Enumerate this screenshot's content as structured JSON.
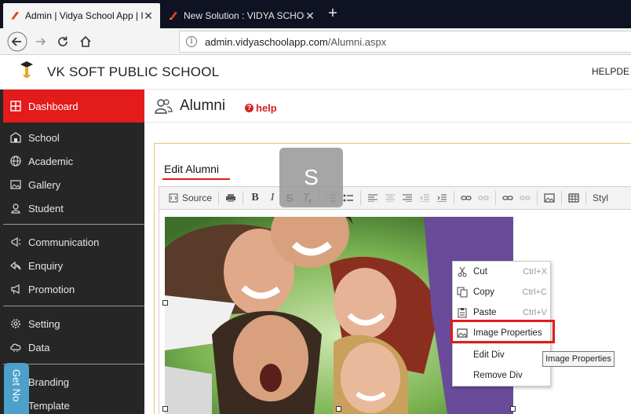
{
  "browser": {
    "tabs": [
      {
        "title": "Admin | Vidya School App | It's",
        "active": true
      },
      {
        "title": "New Solution : VIDYA SCHOOL",
        "active": false
      }
    ],
    "new_tab_label": "+",
    "url_host": "admin.vidyaschoolapp.com",
    "url_path": "/Alumni.aspx"
  },
  "header": {
    "logo_text": "VK SOFT",
    "school_name": "VK SOFT PUBLIC SCHOOL",
    "helpdesk": "HELPDE"
  },
  "sidebar": {
    "items": [
      {
        "label": "Dashboard",
        "icon": "dashboard-icon"
      },
      {
        "label": "School",
        "icon": "school-icon"
      },
      {
        "label": "Academic",
        "icon": "globe-icon"
      },
      {
        "label": "Gallery",
        "icon": "image-icon"
      },
      {
        "label": "Student",
        "icon": "student-icon"
      },
      {
        "label": "Communication",
        "icon": "megaphone-icon"
      },
      {
        "label": "Enquiry",
        "icon": "reply-icon"
      },
      {
        "label": "Promotion",
        "icon": "bullhorn-icon"
      },
      {
        "label": "Setting",
        "icon": "gear-icon"
      },
      {
        "label": "Data",
        "icon": "cloud-icon"
      },
      {
        "label": "Branding",
        "icon": ""
      },
      {
        "label": "Template",
        "icon": ""
      }
    ],
    "get_notified": "Get No"
  },
  "page": {
    "title": "Alumni",
    "help": "help",
    "edit_title": "Edit Alumni",
    "avatar_letter": "S"
  },
  "toolbar": {
    "source_label": "Source",
    "bold": "B",
    "italic": "I",
    "strike": "S",
    "styles_label": "Styl"
  },
  "context_menu": {
    "items": [
      {
        "label": "Cut",
        "shortcut": "Ctrl+X",
        "icon": "scissors-icon"
      },
      {
        "label": "Copy",
        "shortcut": "Ctrl+C",
        "icon": "copy-icon"
      },
      {
        "label": "Paste",
        "shortcut": "Ctrl+V",
        "icon": "paste-icon"
      },
      {
        "label": "Image Properties",
        "shortcut": "",
        "icon": "image-icon"
      },
      {
        "label": "Edit Div",
        "shortcut": "",
        "icon": ""
      },
      {
        "label": "Remove Div",
        "shortcut": "",
        "icon": ""
      }
    ],
    "tooltip": "Image Properties"
  },
  "colors": {
    "accent_red": "#e31b1b",
    "sidebar_bg": "#262626",
    "tab_bar": "#0f1222"
  }
}
